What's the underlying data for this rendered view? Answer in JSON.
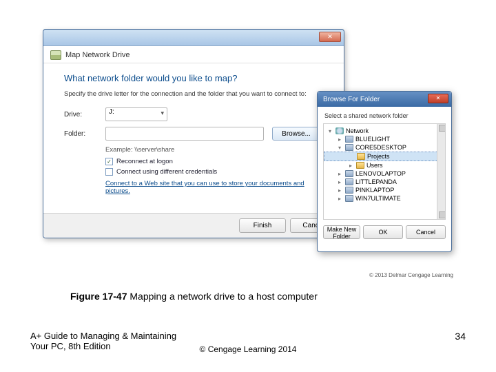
{
  "main": {
    "header_title": "Map Network Drive",
    "close_glyph": "✕",
    "question": "What network folder would you like to map?",
    "subtext": "Specify the drive letter for the connection and the folder that you want to connect to:",
    "drive_label": "Drive:",
    "drive_value": "J:",
    "folder_label": "Folder:",
    "folder_value": "",
    "browse_label": "Browse...",
    "example": "Example: \\\\server\\share",
    "reconnect_label": "Reconnect at logon",
    "diff_creds_label": "Connect using different credentials",
    "link_text": "Connect to a Web site that you can use to store your documents and pictures.",
    "finish_label": "Finish",
    "cancel_label": "Cancel"
  },
  "browse": {
    "title": "Browse For Folder",
    "close_glyph": "✕",
    "subtitle": "Select a shared network folder",
    "tree": {
      "network": "Network",
      "bluelight": "BLUELIGHT",
      "core5": "CORE5DESKTOP",
      "projects": "Projects",
      "users": "Users",
      "lenovo": "LENOVOLAPTOP",
      "littlepanda": "LITTLEPANDA",
      "pinklaptop": "PINKLAPTOP",
      "win7ultimate": "WIN7ULTIMATE"
    },
    "new_folder_label": "Make New Folder",
    "ok_label": "OK",
    "cancel_label": "Cancel"
  },
  "credit": "© 2013 Delmar Cengage Learning",
  "caption_bold": "Figure 17-47",
  "caption_rest": "  Mapping a network drive to a host computer",
  "footer_left1": "A+ Guide to Managing & Maintaining",
  "footer_left2": "Your PC, 8th Edition",
  "footer_center": "©  Cengage Learning 2014",
  "page_number": "34"
}
